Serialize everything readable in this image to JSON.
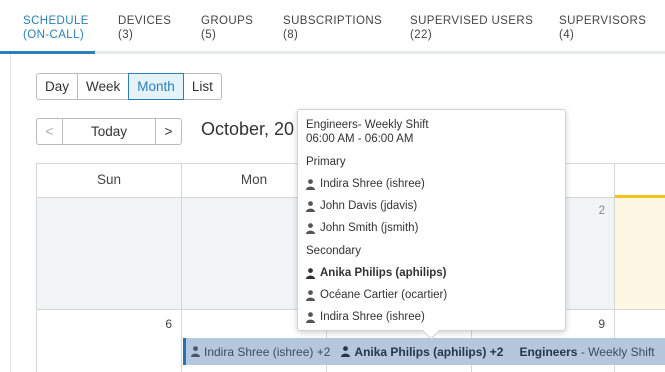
{
  "tabs": [
    {
      "line1": "SCHEDULE",
      "line2": "(ON-CALL)",
      "active": true
    },
    {
      "line1": "DEVICES",
      "line2": "(3)"
    },
    {
      "line1": "GROUPS",
      "line2": "(5)"
    },
    {
      "line1": "SUBSCRIPTIONS",
      "line2": "(8)"
    },
    {
      "line1": "SUPERVISED USERS",
      "line2": "(22)"
    },
    {
      "line1": "SUPERVISORS",
      "line2": "(4)"
    }
  ],
  "views": {
    "day": "Day",
    "week": "Week",
    "month": "Month",
    "list": "List",
    "selected": "Month"
  },
  "nav": {
    "prev": "<",
    "today": "Today",
    "next": ">"
  },
  "month_title": "October, 20",
  "weekdays": {
    "sun": "Sun",
    "mon": "Mon"
  },
  "days": {
    "d2": "2",
    "d6": "6",
    "d9": "9"
  },
  "popup": {
    "title": "Engineers- Weekly Shift",
    "time": "06:00 AM - 06:00 AM",
    "primary_label": "Primary",
    "primary": [
      "Indira Shree (ishree)",
      "John Davis (jdavis)",
      "John Smith (jsmith)"
    ],
    "secondary_label": "Secondary",
    "secondary": [
      "Anika Philips (aphilips)",
      "Océane Cartier (ocartier)",
      "Indira Shree (ishree)"
    ]
  },
  "event": {
    "primary_summary": "Indira Shree (ishree) +2",
    "secondary_summary": "Anika Philips (aphilips) +2",
    "group": "Engineers",
    "separator": "-",
    "shift": "Weekly Shift"
  },
  "colors": {
    "accent": "#2c7fb8",
    "today": "#f5c21b",
    "event": "#b5c7dd"
  }
}
